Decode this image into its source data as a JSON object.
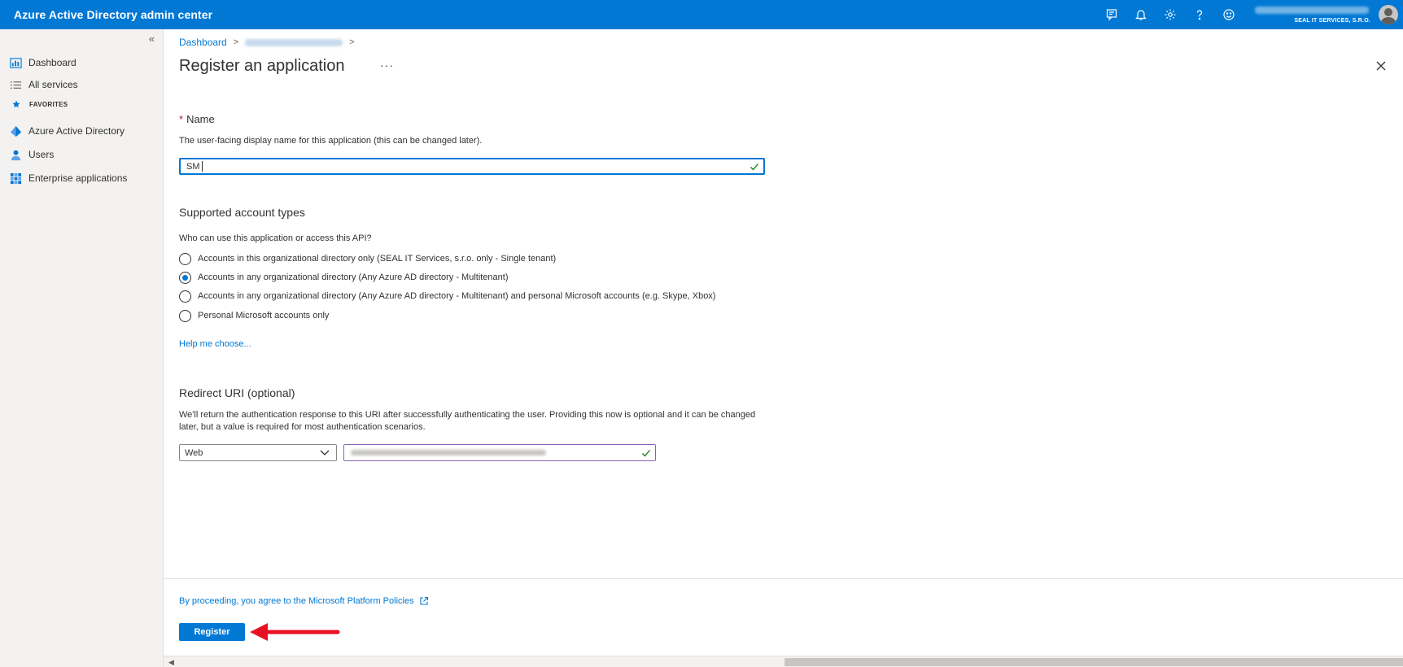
{
  "topbar": {
    "title": "Azure Active Directory admin center",
    "org": "SEAL IT SERVICES, S.R.O.",
    "icons": [
      "feedback-icon",
      "bell-icon",
      "gear-icon",
      "help-icon",
      "smiley-icon"
    ]
  },
  "sidebar": {
    "collapse": "«",
    "items": [
      {
        "label": "Dashboard",
        "icon": "dashboard-icon"
      },
      {
        "label": "All services",
        "icon": "list-icon"
      },
      {
        "label": "FAVORITES",
        "icon": "star-icon"
      },
      {
        "label": "Azure Active Directory",
        "icon": "aad-icon"
      },
      {
        "label": "Users",
        "icon": "user-icon"
      },
      {
        "label": "Enterprise applications",
        "icon": "grid-icon"
      }
    ]
  },
  "breadcrumb": {
    "home": "Dashboard",
    "sep": ">"
  },
  "page": {
    "title": "Register an application",
    "ellipsis": "···"
  },
  "name_section": {
    "required_mark": "*",
    "label": "Name",
    "description": "The user-facing display name for this application (this can be changed later).",
    "value": "SM"
  },
  "account_types": {
    "label": "Supported account types",
    "question": "Who can use this application or access this API?",
    "options": [
      "Accounts in this organizational directory only (SEAL IT Services, s.r.o. only - Single tenant)",
      "Accounts in any organizational directory (Any Azure AD directory - Multitenant)",
      "Accounts in any organizational directory (Any Azure AD directory - Multitenant) and personal Microsoft accounts (e.g. Skype, Xbox)",
      "Personal Microsoft accounts only"
    ],
    "selected_index": 1,
    "help_link": "Help me choose..."
  },
  "redirect": {
    "label": "Redirect URI (optional)",
    "description": "We'll return the authentication response to this URI after successfully authenticating the user. Providing this now is optional and it can be changed later, but a value is required for most authentication scenarios.",
    "platform": "Web"
  },
  "footer": {
    "policy_text": "By proceeding, you agree to the Microsoft Platform Policies",
    "register_label": "Register"
  },
  "colors": {
    "brand": "#0078d4",
    "annotation_arrow": "#e81123"
  }
}
